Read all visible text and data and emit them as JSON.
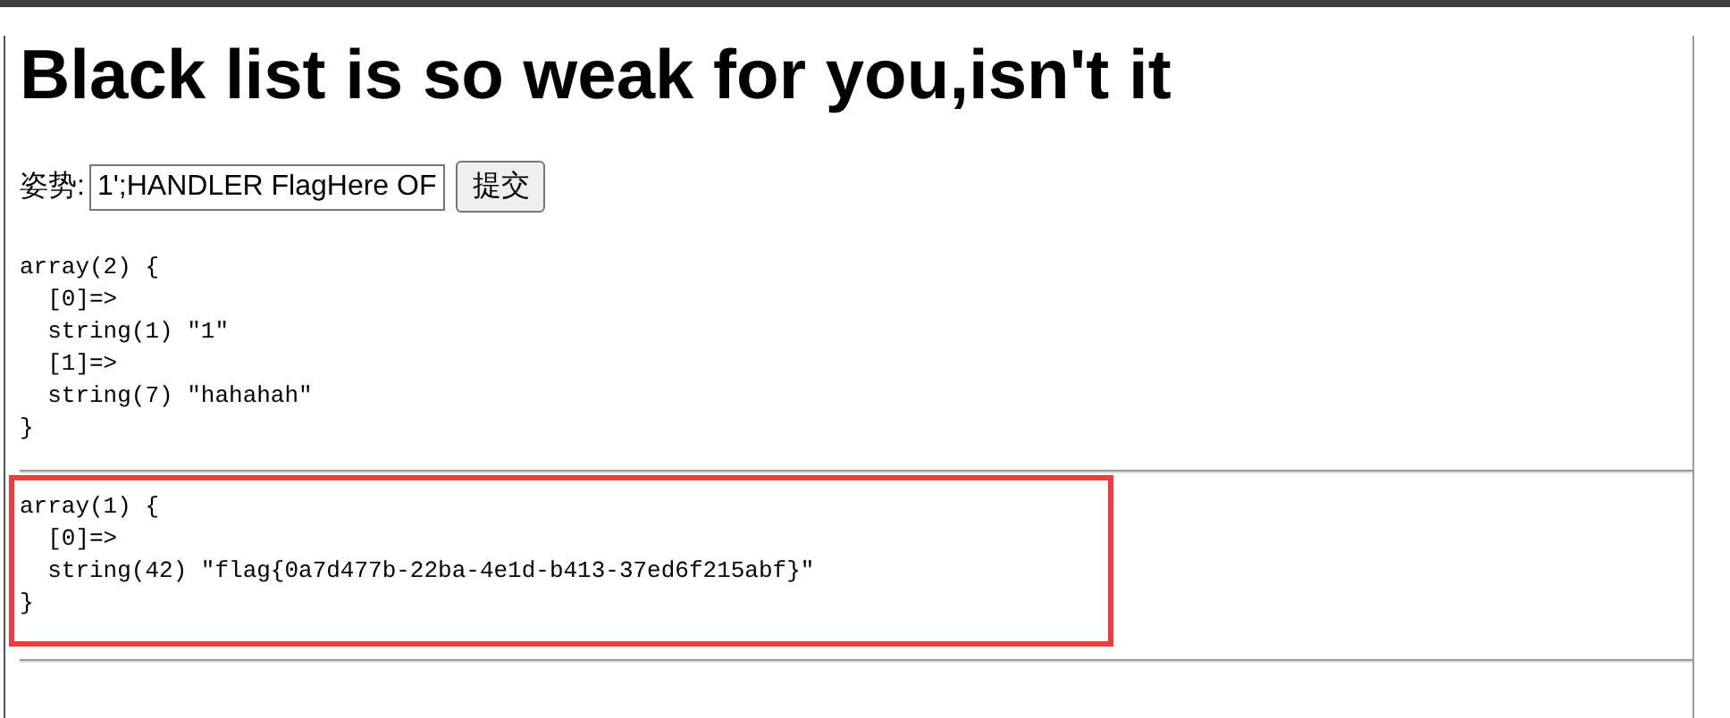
{
  "heading": "Black list is so weak for you,isn't it",
  "form": {
    "label": "姿势:",
    "value": "1';HANDLER FlagHere OF",
    "button": "提交"
  },
  "dumps": [
    {
      "text": "array(2) {\n  [0]=>\n  string(1) \"1\"\n  [1]=>\n  string(7) \"hahahah\"\n}",
      "highlighted": false
    },
    {
      "text": "array(1) {\n  [0]=>\n  string(42) \"flag{0a7d477b-22ba-4e1d-b413-37ed6f215abf}\"\n}",
      "highlighted": true
    }
  ]
}
